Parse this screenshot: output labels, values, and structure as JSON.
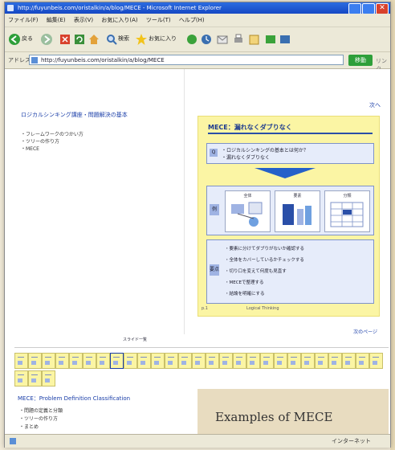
{
  "window": {
    "title": "http://fuyunbeis.com/oristalkin/a/blog/MECE - Microsoft Internet Explorer",
    "close_glyph": "✕"
  },
  "menu": [
    "ファイル(F)",
    "編集(E)",
    "表示(V)",
    "お気に入り(A)",
    "ツール(T)",
    "ヘルプ(H)"
  ],
  "toolbar": {
    "back_label": "戻る",
    "search_label": "検索",
    "favorites_label": "お気に入り"
  },
  "address": {
    "label": "アドレス",
    "value": "http://fuyunbeis.com/oristalkin/a/blog/MECE",
    "go_label": "移動",
    "links_label": "リンク"
  },
  "left_pane": {
    "title_link": "ロジカルシンキング講座・問題解決の基本",
    "items": [
      "・フレームワークのつかい方",
      "・ツリーの作り方",
      "・MECE"
    ]
  },
  "slide": {
    "top_link": "次へ",
    "title": "MECE：漏れなくダブりなく",
    "box1_tag": "Q",
    "box1_line1": "・ロジカルシンキングの基本とは何か？",
    "box1_line2": "・漏れなくダブりなく",
    "box2_tag": "例",
    "panel_captions": [
      "全体",
      "要素",
      "分類"
    ],
    "box3_tag": "要点",
    "bullets": [
      "・要素に分けてダブりがないか確認する",
      "・全体をカバーしているかチェックする",
      "・切り口を変えて何度も見直す",
      "・MECEで整理する",
      "・結論を明確にする"
    ],
    "slide_number": "p.1",
    "footer": "Logical Thinking"
  },
  "next_link": "次のページ",
  "thumb_strip_label": "スライド一覧",
  "bottom": {
    "link": "MECE：Problem Definition Classification",
    "items": [
      "・問題の定義と分類",
      "・ツリーの作り方",
      "・まとめ"
    ],
    "slide_heading": "Examples of MECE"
  },
  "status": {
    "zone": "インターネット"
  },
  "colors": {
    "titlebar": "#1648c4",
    "slide_bg": "#fbf5a4",
    "link": "#1a3ea8",
    "accent": "#2560c9"
  }
}
